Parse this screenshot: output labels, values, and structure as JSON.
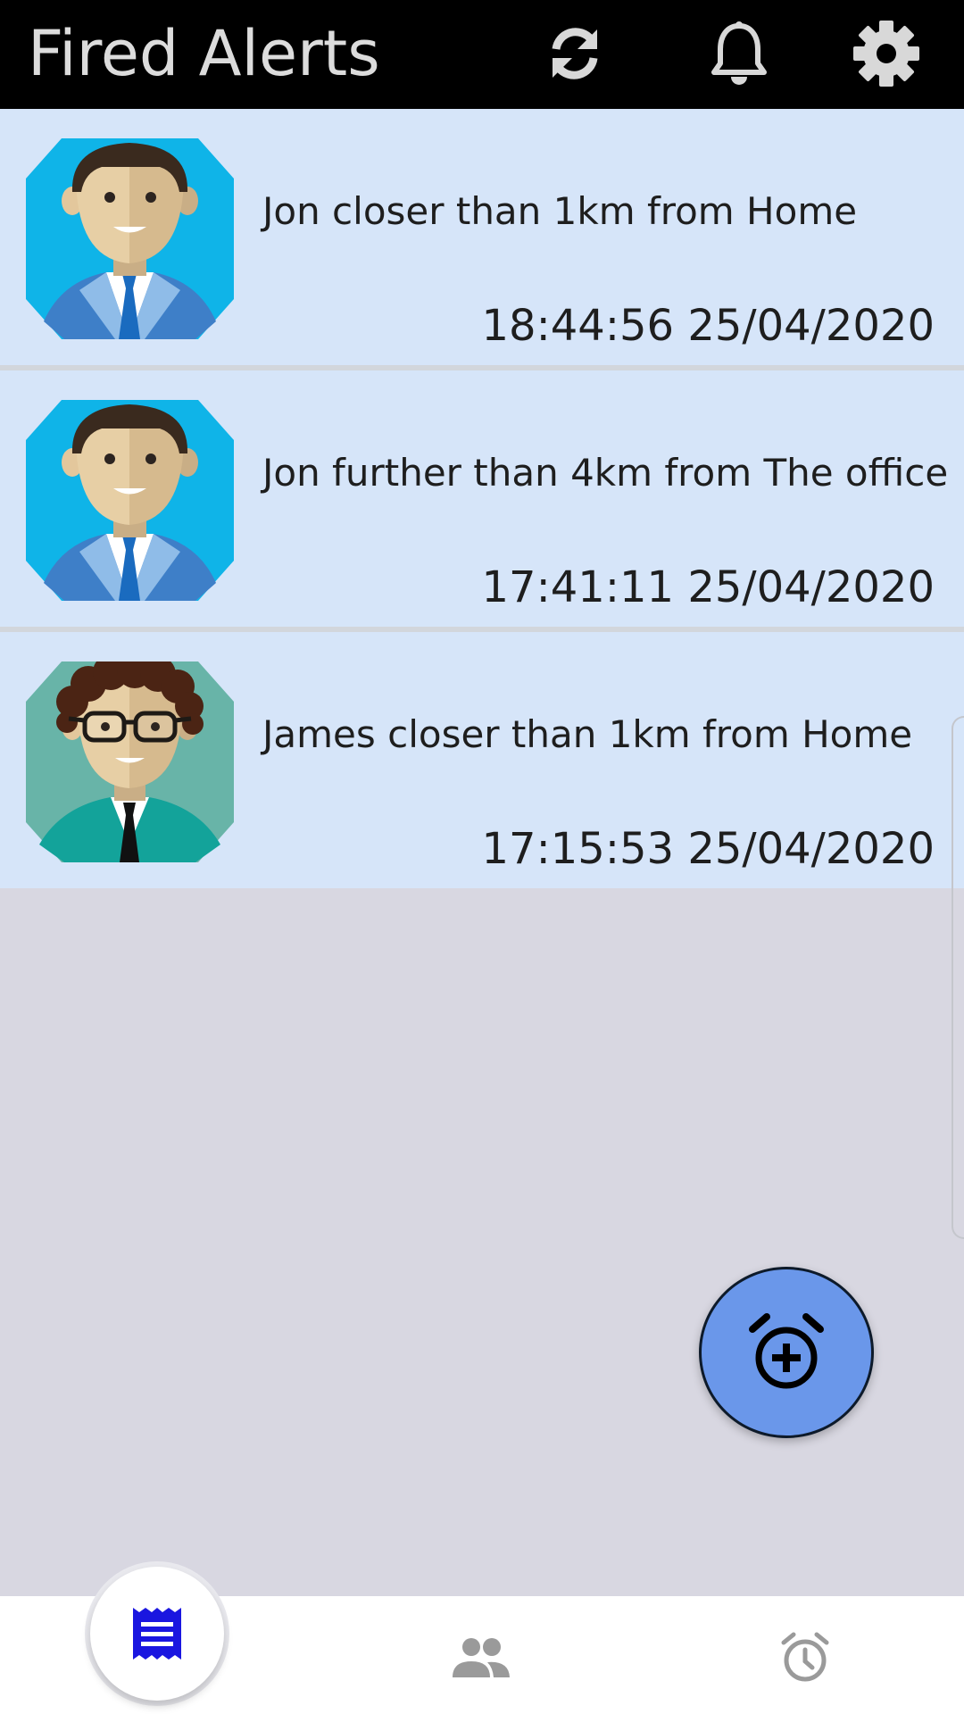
{
  "app_bar": {
    "title": "Fired Alerts",
    "background": "#000000",
    "actions": [
      {
        "icon": "refresh-icon"
      },
      {
        "icon": "bell-icon"
      },
      {
        "icon": "gear-icon"
      }
    ]
  },
  "alerts": [
    {
      "avatar": "businessman-avatar",
      "message": "Jon closer than 1km from Home",
      "timestamp": "18:44:56 25/04/2020"
    },
    {
      "avatar": "businessman-avatar",
      "message": "Jon further than 4km from The office",
      "timestamp": "17:41:11 25/04/2020"
    },
    {
      "avatar": "curly-hair-glasses-avatar",
      "message": "James closer than 1km from Home",
      "timestamp": "17:15:53 25/04/2020"
    }
  ],
  "fab": {
    "icon": "add-alarm-icon",
    "color": "#6a97ea"
  },
  "bottom_nav": {
    "items": [
      {
        "icon": "receipt-list-icon",
        "selected": true,
        "color": "#1a16e0"
      },
      {
        "icon": "people-icon",
        "selected": false,
        "color": "#9a9a9a"
      },
      {
        "icon": "alarm-clock-icon",
        "selected": false,
        "color": "#9a9a9a"
      }
    ]
  },
  "colors": {
    "row_background": "#d6e5f9",
    "page_background": "#d8d7e1",
    "text": "#1e1e1e"
  }
}
